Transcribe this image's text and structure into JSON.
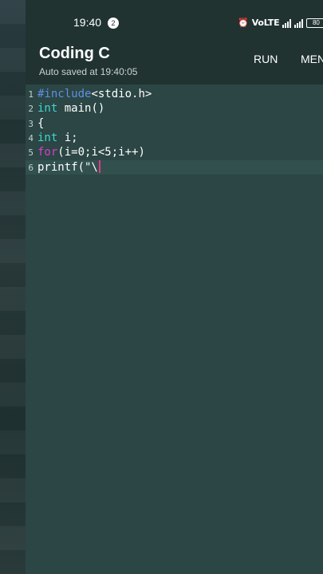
{
  "status_bar": {
    "time": "19:40",
    "notification_count": "2",
    "network_label": "VoLTE",
    "battery": "80"
  },
  "app_bar": {
    "title": "Coding C",
    "subtitle": "Auto saved at 19:40:05",
    "run_label": "RUN",
    "menu_label": "MENU"
  },
  "editor": {
    "lines": [
      {
        "num": "1",
        "segments": [
          {
            "text": "#include",
            "kind": "include"
          },
          {
            "text": "<stdio.h>",
            "kind": "plain"
          }
        ]
      },
      {
        "num": "2",
        "segments": [
          {
            "text": "int",
            "kind": "type"
          },
          {
            "text": " main()",
            "kind": "plain"
          }
        ]
      },
      {
        "num": "3",
        "segments": [
          {
            "text": "{",
            "kind": "plain"
          }
        ]
      },
      {
        "num": "4",
        "segments": [
          {
            "text": "int",
            "kind": "type"
          },
          {
            "text": " i;",
            "kind": "plain"
          }
        ]
      },
      {
        "num": "5",
        "segments": [
          {
            "text": "for",
            "kind": "ctrl"
          },
          {
            "text": "(i=0;i<5;i++)",
            "kind": "plain"
          }
        ]
      },
      {
        "num": "6",
        "segments": [
          {
            "text": "printf(\"\\",
            "kind": "plain"
          }
        ]
      }
    ],
    "colors": {
      "include": "#5f8fe6",
      "type": "#3fd6d0",
      "ctrl": "#d43fcf",
      "cursor": "#e03a8c"
    }
  }
}
